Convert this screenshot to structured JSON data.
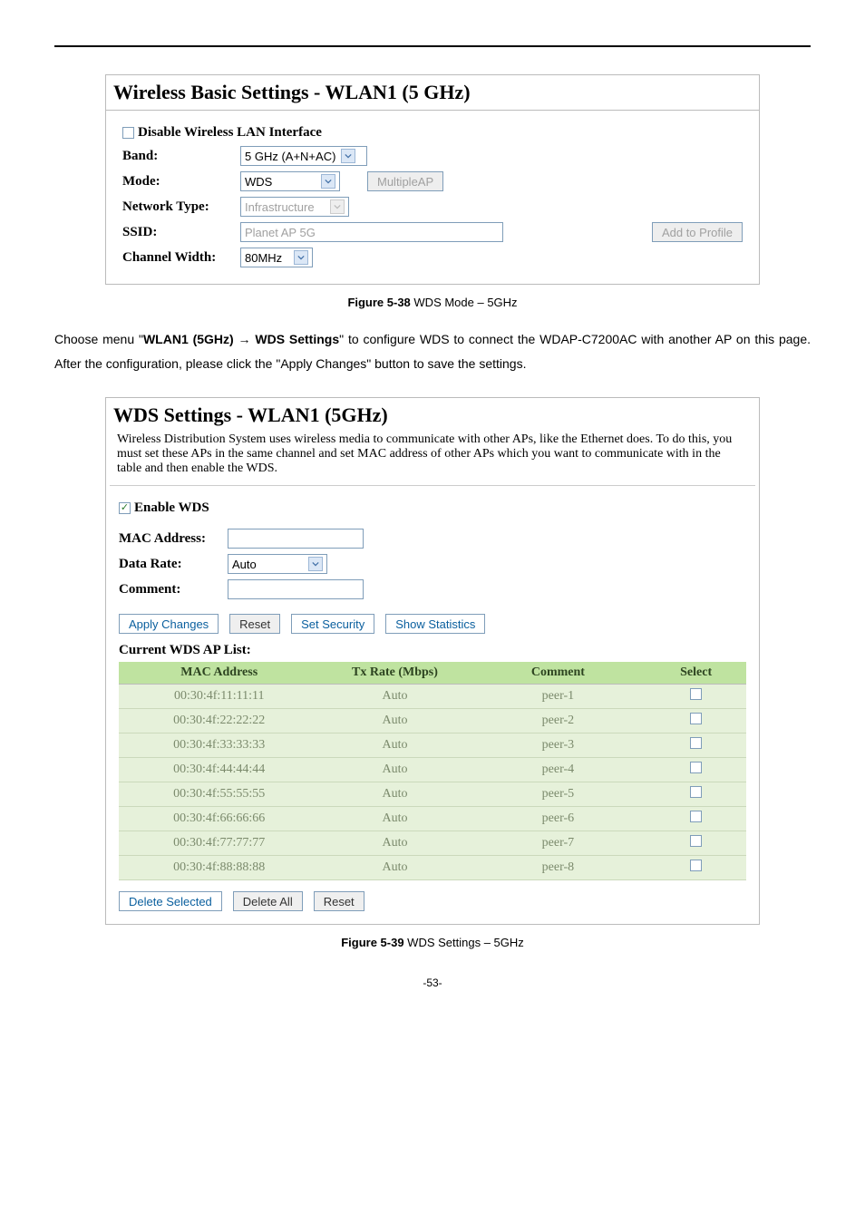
{
  "panel1": {
    "title": "Wireless Basic Settings - WLAN1 (5 GHz)",
    "disable_label": "Disable Wireless LAN Interface",
    "band_label": "Band:",
    "band_value": "5 GHz (A+N+AC)",
    "mode_label": "Mode:",
    "mode_value": "WDS",
    "multiap_btn": "MultipleAP",
    "nettype_label": "Network Type:",
    "nettype_value": "Infrastructure",
    "ssid_label": "SSID:",
    "ssid_value": "Planet AP 5G",
    "addprofile_btn": "Add to Profile",
    "chwidth_label": "Channel Width:",
    "chwidth_value": "80MHz"
  },
  "caption1": {
    "bold": "Figure 5-38",
    "rest": " WDS Mode – 5GHz"
  },
  "paragraph": {
    "p1a": "Choose menu \"",
    "p1b": "WLAN1 (5GHz) ",
    "arrow": "→",
    "p1c": " WDS Settings",
    "p1d": "\" to configure WDS to connect the WDAP-C7200AC with another AP on this page. After the configuration, please click the \"Apply Changes\" button to save the settings."
  },
  "wds": {
    "title": "WDS Settings - WLAN1 (5GHz)",
    "desc": "Wireless Distribution System uses wireless media to communicate with other APs, like the Ethernet does. To do this, you must set these APs in the same channel and set MAC address of other APs which you want to communicate with in the table and then enable the WDS.",
    "enable_label": "Enable WDS",
    "mac_label": "MAC Address:",
    "rate_label": "Data Rate:",
    "rate_value": "Auto",
    "comment_label": "Comment:",
    "apply_btn": "Apply Changes",
    "reset_btn": "Reset",
    "sec_btn": "Set Security",
    "stats_btn": "Show Statistics",
    "list_label": "Current WDS AP List:",
    "th_mac": "MAC Address",
    "th_rate": "Tx Rate (Mbps)",
    "th_comment": "Comment",
    "th_select": "Select",
    "rows": [
      {
        "mac": "00:30:4f:11:11:11",
        "rate": "Auto",
        "comment": "peer-1"
      },
      {
        "mac": "00:30:4f:22:22:22",
        "rate": "Auto",
        "comment": "peer-2"
      },
      {
        "mac": "00:30:4f:33:33:33",
        "rate": "Auto",
        "comment": "peer-3"
      },
      {
        "mac": "00:30:4f:44:44:44",
        "rate": "Auto",
        "comment": "peer-4"
      },
      {
        "mac": "00:30:4f:55:55:55",
        "rate": "Auto",
        "comment": "peer-5"
      },
      {
        "mac": "00:30:4f:66:66:66",
        "rate": "Auto",
        "comment": "peer-6"
      },
      {
        "mac": "00:30:4f:77:77:77",
        "rate": "Auto",
        "comment": "peer-7"
      },
      {
        "mac": "00:30:4f:88:88:88",
        "rate": "Auto",
        "comment": "peer-8"
      }
    ],
    "del_sel_btn": "Delete Selected",
    "del_all_btn": "Delete All",
    "reset2_btn": "Reset"
  },
  "caption2": {
    "bold": "Figure 5-39",
    "rest": " WDS Settings – 5GHz"
  },
  "pagenum": "-53-"
}
